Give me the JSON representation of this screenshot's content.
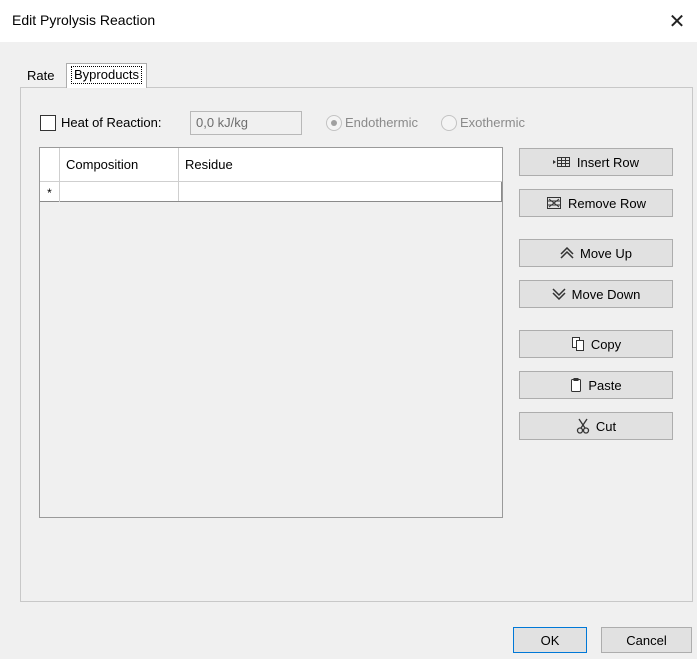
{
  "window": {
    "title": "Edit Pyrolysis Reaction",
    "close_glyph": "✕"
  },
  "tabs": [
    {
      "label": "Rate",
      "active": false
    },
    {
      "label": "Byproducts",
      "active": true
    }
  ],
  "heat": {
    "checkbox_label": "Heat of Reaction:",
    "checked": false,
    "value": "0,0 kJ/kg",
    "radios": [
      {
        "label": "Endothermic",
        "checked": true,
        "enabled": false
      },
      {
        "label": "Exothermic",
        "checked": false,
        "enabled": false
      }
    ]
  },
  "table": {
    "columns": [
      "Composition",
      "Residue"
    ],
    "new_row_marker": "*",
    "rows": []
  },
  "buttons": {
    "insert_row": "Insert Row",
    "remove_row": "Remove Row",
    "move_up": "Move Up",
    "move_down": "Move Down",
    "copy": "Copy",
    "paste": "Paste",
    "cut": "Cut",
    "ok": "OK",
    "cancel": "Cancel"
  },
  "icons": [
    "insert-row-icon",
    "remove-row-icon",
    "move-up-icon",
    "move-down-icon",
    "copy-icon",
    "paste-icon",
    "cut-icon",
    "close-icon"
  ],
  "colors": {
    "ok_border": "#0078d7",
    "button_face": "#e1e1e1",
    "window_bg": "#f0f0f0"
  }
}
